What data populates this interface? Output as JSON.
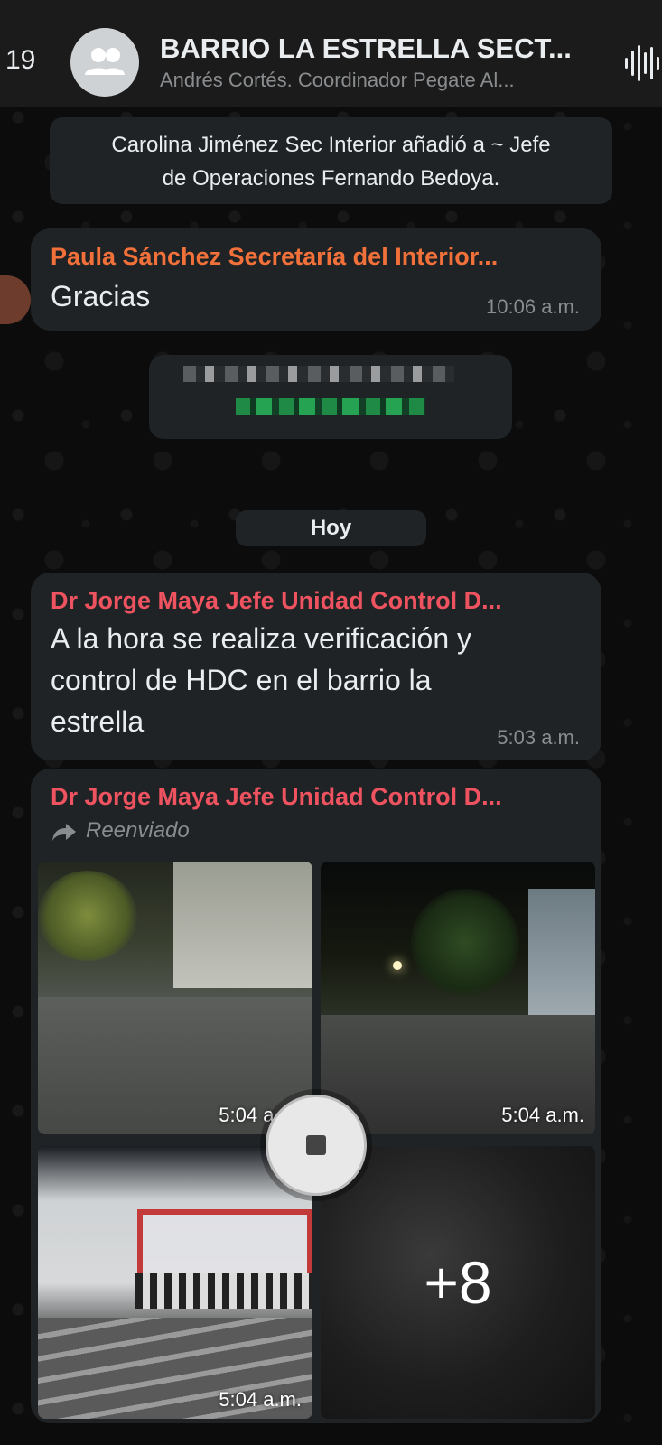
{
  "header": {
    "back_count": "19",
    "title": "BARRIO LA ESTRELLA SECT...",
    "subtitle": "Andrés Cortés. Coordinador Pegate Al..."
  },
  "system_message": {
    "line1": "Carolina Jiménez Sec Interior añadió a ~ Jefe",
    "line2": "de Operaciones Fernando Bedoya."
  },
  "messages": [
    {
      "sender": "Paula Sánchez Secretaría del Interior...",
      "sender_color": "#f2713a",
      "text": "Gracias",
      "time": "10:06 a.m."
    },
    {
      "sender": "Dr Jorge Maya Jefe Unidad Control D...",
      "sender_color": "#ef5360",
      "text_lines": [
        "A la hora se realiza verificación y",
        "control de HDC en el barrio la",
        "estrella"
      ],
      "time": "5:03 a.m."
    }
  ],
  "date_divider": "Hoy",
  "album": {
    "sender": "Dr Jorge Maya Jefe Unidad Control D...",
    "forwarded_label": "Reenviado",
    "photos": [
      {
        "time": "5:04 a.m."
      },
      {
        "time": "5:04 a.m."
      },
      {
        "time": "5:04 a.m."
      }
    ],
    "more_count": "+8"
  },
  "icons": {
    "avatar": "group-icon",
    "voice": "waveform-icon",
    "forward": "forward-arrow-icon",
    "stop": "stop-icon"
  }
}
